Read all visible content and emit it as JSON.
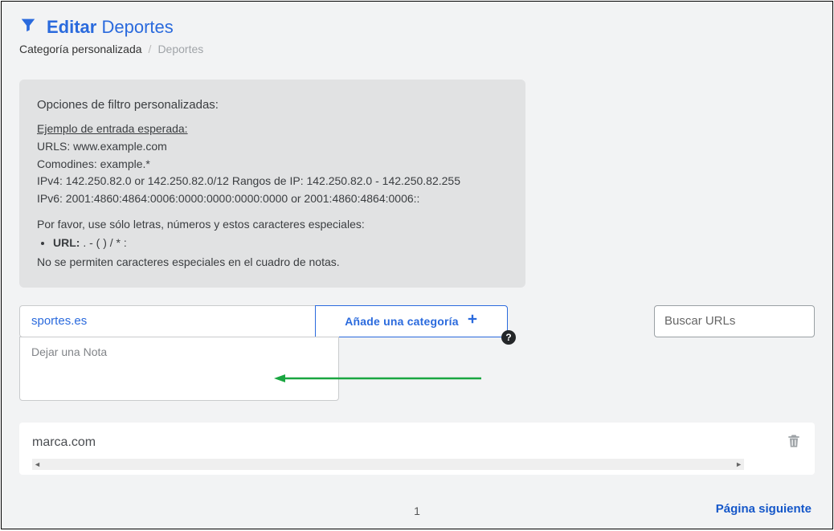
{
  "header": {
    "title_bold": "Editar",
    "title_rest": "Deportes"
  },
  "breadcrumb": {
    "parent": "Categoría personalizada",
    "current": "Deportes"
  },
  "info": {
    "heading": "Opciones de filtro personalizadas:",
    "example_label": "Ejemplo de entrada esperada:",
    "urls_line": "URLS: www.example.com",
    "wildcards_line": "Comodines: example.*",
    "ipv4_line": "IPv4: 142.250.82.0 or 142.250.82.0/12 Rangos de IP: 142.250.82.0 - 142.250.82.255",
    "ipv6_line": "IPv6: 2001:4860:4864:0006:0000:0000:0000:0000 or 2001:4860:4864:0006::",
    "charset_intro": "Por favor, use sólo letras, números y estos caracteres especiales:",
    "url_label": "URL:",
    "url_chars": ". - ( ) / * :",
    "no_special": "No se permiten caracteres especiales en el cuadro de notas."
  },
  "form": {
    "url_value": "sportes.es",
    "add_label": "Añade una categoría",
    "note_placeholder": "Dejar una Nota",
    "search_placeholder": "Buscar URLs"
  },
  "list": {
    "items": [
      "marca.com"
    ]
  },
  "pagination": {
    "current": "1",
    "next_label": "Página siguiente"
  },
  "colors": {
    "primary": "#2a6add",
    "arrow": "#1aa641"
  }
}
